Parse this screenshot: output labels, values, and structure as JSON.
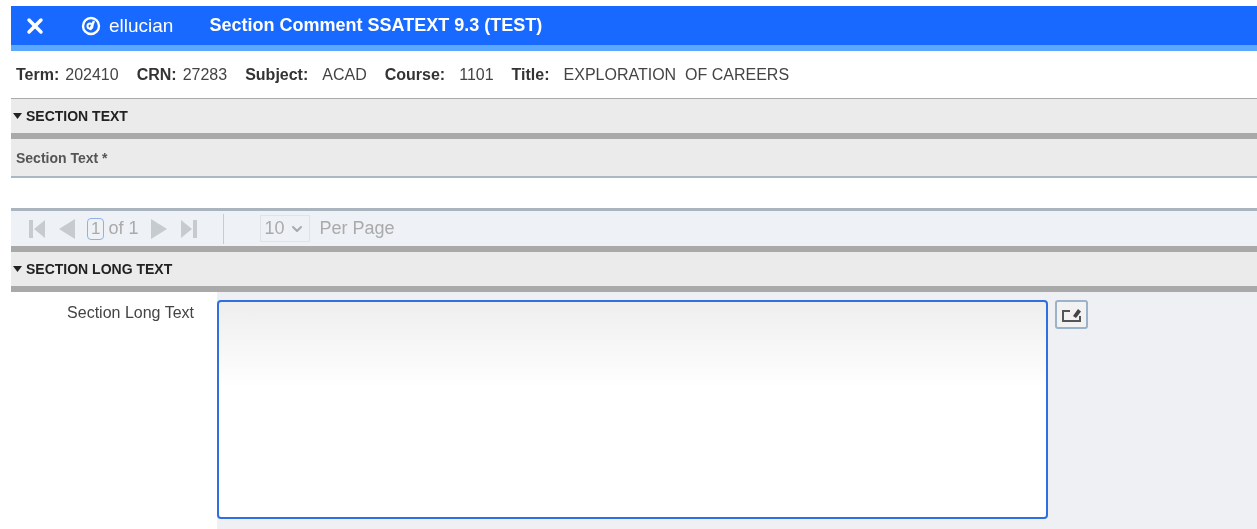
{
  "header": {
    "brand": "ellucian",
    "title": "Section Comment SSATEXT 9.3 (TEST)"
  },
  "info": [
    {
      "label": "Term:",
      "value": "202410"
    },
    {
      "label": "CRN:",
      "value": "27283"
    },
    {
      "label": "Subject:",
      "value": "ACAD"
    },
    {
      "label": "Course:",
      "value": "1101"
    },
    {
      "label": "Title:",
      "value": "EXPLORATION  OF CAREERS"
    }
  ],
  "section_text": {
    "heading": "SECTION TEXT",
    "expanded": true,
    "column": "Section Text *"
  },
  "pager": {
    "first_disabled": true,
    "prev_disabled": true,
    "next_disabled": true,
    "last_disabled": true,
    "page": "1",
    "of": "of 1",
    "per_page": "10",
    "per_page_label": "Per Page"
  },
  "section_long_text": {
    "heading": "SECTION LONG TEXT",
    "expanded": true,
    "label": "Section Long Text"
  }
}
